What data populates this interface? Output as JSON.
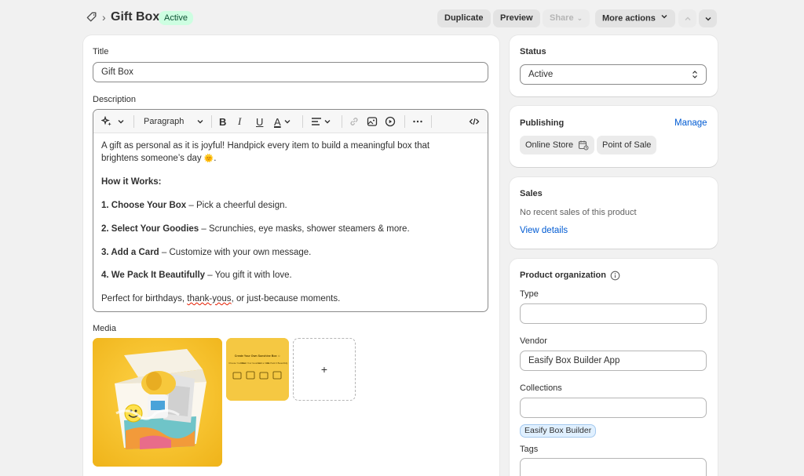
{
  "header": {
    "title": "Gift Box",
    "status": "Active",
    "duplicate": "Duplicate",
    "preview": "Preview",
    "share": "Share",
    "more_actions": "More actions"
  },
  "main": {
    "title_label": "Title",
    "title_value": "Gift Box",
    "description_label": "Description",
    "toolbar_paragraph": "Paragraph",
    "desc": {
      "intro1": "A gift as personal as it is joyful! Handpick every item to build a meaningful box that",
      "intro2": "brightens someone’s day ",
      "sun": "🌞",
      "period": ".",
      "how": "How it Works:",
      "s1b": "1. Choose Your Box",
      "s1": " – Pick a cheerful design.",
      "s2b": "2. Select Your Goodies",
      "s2": " – Scrunchies, eye masks, shower steamers & more.",
      "s3b": "3. Add a Card",
      "s3": " – Customize with your own message.",
      "s4b": "4. We Pack It Beautifully",
      "s4": " – You gift it with love.",
      "outro_a": "Perfect for birthdays, ",
      "outro_b": "thank-yous",
      "outro_c": ", or just-because moments."
    },
    "media_label": "Media",
    "media_add": "+",
    "thumb_title": "Create Your Own Sunshine Box ☺",
    "thumb_steps": [
      "Choose Your Box",
      "Select Your Goodies",
      "Add a Card",
      "We Pack It Beautifully"
    ]
  },
  "sidebar": {
    "status_label": "Status",
    "status_value": "Active",
    "publishing_label": "Publishing",
    "manage": "Manage",
    "channel1": "Online Store",
    "channel2": "Point of Sale",
    "sales_label": "Sales",
    "sales_text": "No recent sales of this product",
    "view_details": "View details",
    "org_label": "Product organization",
    "type_label": "Type",
    "type_value": "",
    "vendor_label": "Vendor",
    "vendor_value": "Easify Box Builder App",
    "collections_label": "Collections",
    "collections_value": "",
    "collection_chip": "Easify Box Builder",
    "tags_label": "Tags"
  }
}
